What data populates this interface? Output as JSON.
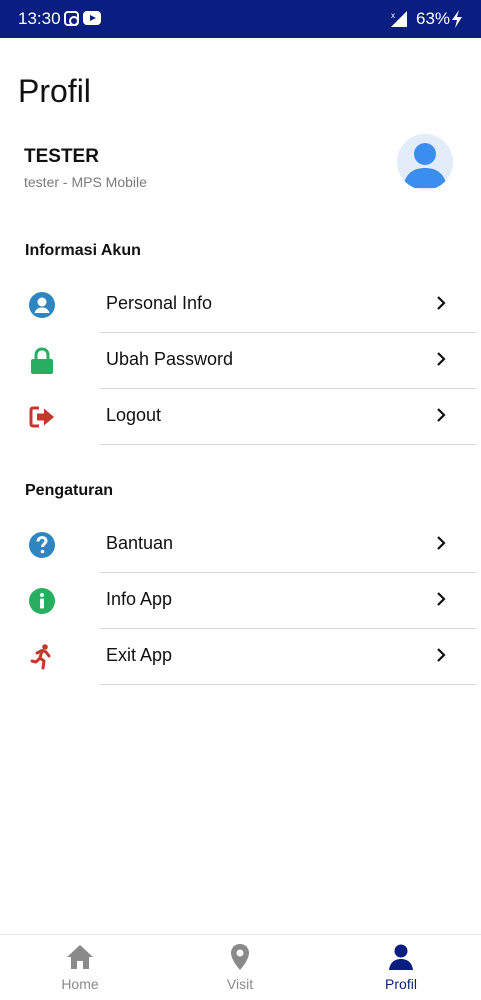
{
  "status_bar": {
    "time": "13:30",
    "battery": "63%"
  },
  "page": {
    "title": "Profil"
  },
  "user": {
    "name": "TESTER",
    "subtitle": "tester - MPS Mobile"
  },
  "sections": [
    {
      "title": "Informasi Akun",
      "items": [
        {
          "label": "Personal Info",
          "icon": "user-circle-icon",
          "color": "#2e86c1"
        },
        {
          "label": "Ubah Password",
          "icon": "lock-icon",
          "color": "#27ae60"
        },
        {
          "label": "Logout",
          "icon": "logout-icon",
          "color": "#c0392b"
        }
      ]
    },
    {
      "title": "Pengaturan",
      "items": [
        {
          "label": "Bantuan",
          "icon": "question-circle-icon",
          "color": "#2e86c1"
        },
        {
          "label": "Info App",
          "icon": "info-circle-icon",
          "color": "#27ae60"
        },
        {
          "label": "Exit App",
          "icon": "running-person-icon",
          "color": "#c0392b"
        }
      ]
    }
  ],
  "bottom_nav": {
    "items": [
      {
        "label": "Home",
        "icon": "home-icon",
        "active": false
      },
      {
        "label": "Visit",
        "icon": "map-pin-icon",
        "active": false
      },
      {
        "label": "Profil",
        "icon": "user-icon",
        "active": true
      }
    ],
    "active_color": "#0a1d80",
    "inactive_color": "#8a8a8a"
  }
}
